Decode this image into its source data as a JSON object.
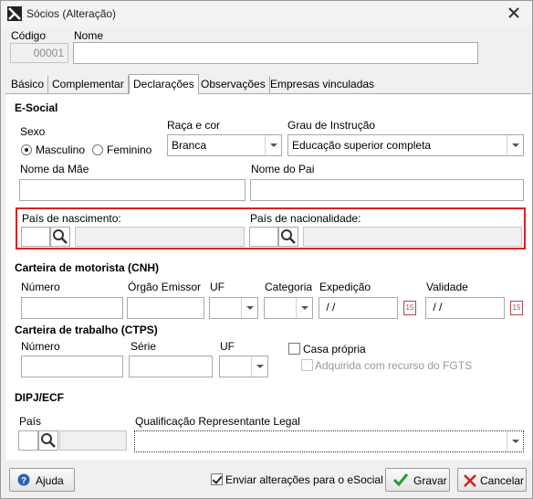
{
  "window": {
    "title": "Sócios (Alteração)"
  },
  "header": {
    "codigo_label": "Código",
    "codigo_value": "00001",
    "nome_label": "Nome",
    "nome_value": ""
  },
  "tabs": [
    {
      "label": "Básico",
      "active": false
    },
    {
      "label": "Complementar",
      "active": false
    },
    {
      "label": "Declarações",
      "active": true
    },
    {
      "label": "Observações",
      "active": false
    },
    {
      "label": "Empresas vinculadas",
      "active": false
    }
  ],
  "esocial": {
    "section_title": "E-Social",
    "sexo_label": "Sexo",
    "sexo_options": [
      "Masculino",
      "Feminino"
    ],
    "sexo_selected": "Masculino",
    "raca_label": "Raça e cor",
    "raca_value": "Branca",
    "grau_label": "Grau de Instrução",
    "grau_value": "Educação superior completa",
    "mae_label": "Nome da Mãe",
    "mae_value": "",
    "pai_label": "Nome do Pai",
    "pai_value": "",
    "pais_nasc_label": "País de nascimento:",
    "pais_nac_label": "País de nacionalidade:"
  },
  "cnh": {
    "section_title": "Carteira de motorista (CNH)",
    "numero_label": "Número",
    "orgao_label": "Órgão Emissor",
    "uf_label": "UF",
    "categoria_label": "Categoria",
    "expedicao_label": "Expedição",
    "expedicao_value": " / /",
    "validade_label": "Validade",
    "validade_value": " / /"
  },
  "ctps": {
    "section_title": "Carteira de trabalho (CTPS)",
    "numero_label": "Número",
    "serie_label": "Série",
    "uf_label": "UF",
    "casa_propria_label": "Casa própria",
    "fgts_label": "Adquirida com recurso do FGTS"
  },
  "dipj": {
    "section_title": "DIPJ/ECF",
    "pais_label": "País",
    "qualificacao_label": "Qualificação Representante Legal"
  },
  "footer": {
    "ajuda_label": "Ajuda",
    "enviar_label": "Enviar alterações para o eSocial",
    "enviar_checked": true,
    "gravar_label": "Gravar",
    "cancelar_label": "Cancelar"
  },
  "colors": {
    "highlight": "#e02020",
    "gravar_check": "#2e9b2e",
    "cancelar_x": "#d02020",
    "help_icon": "#2a5fb8"
  }
}
